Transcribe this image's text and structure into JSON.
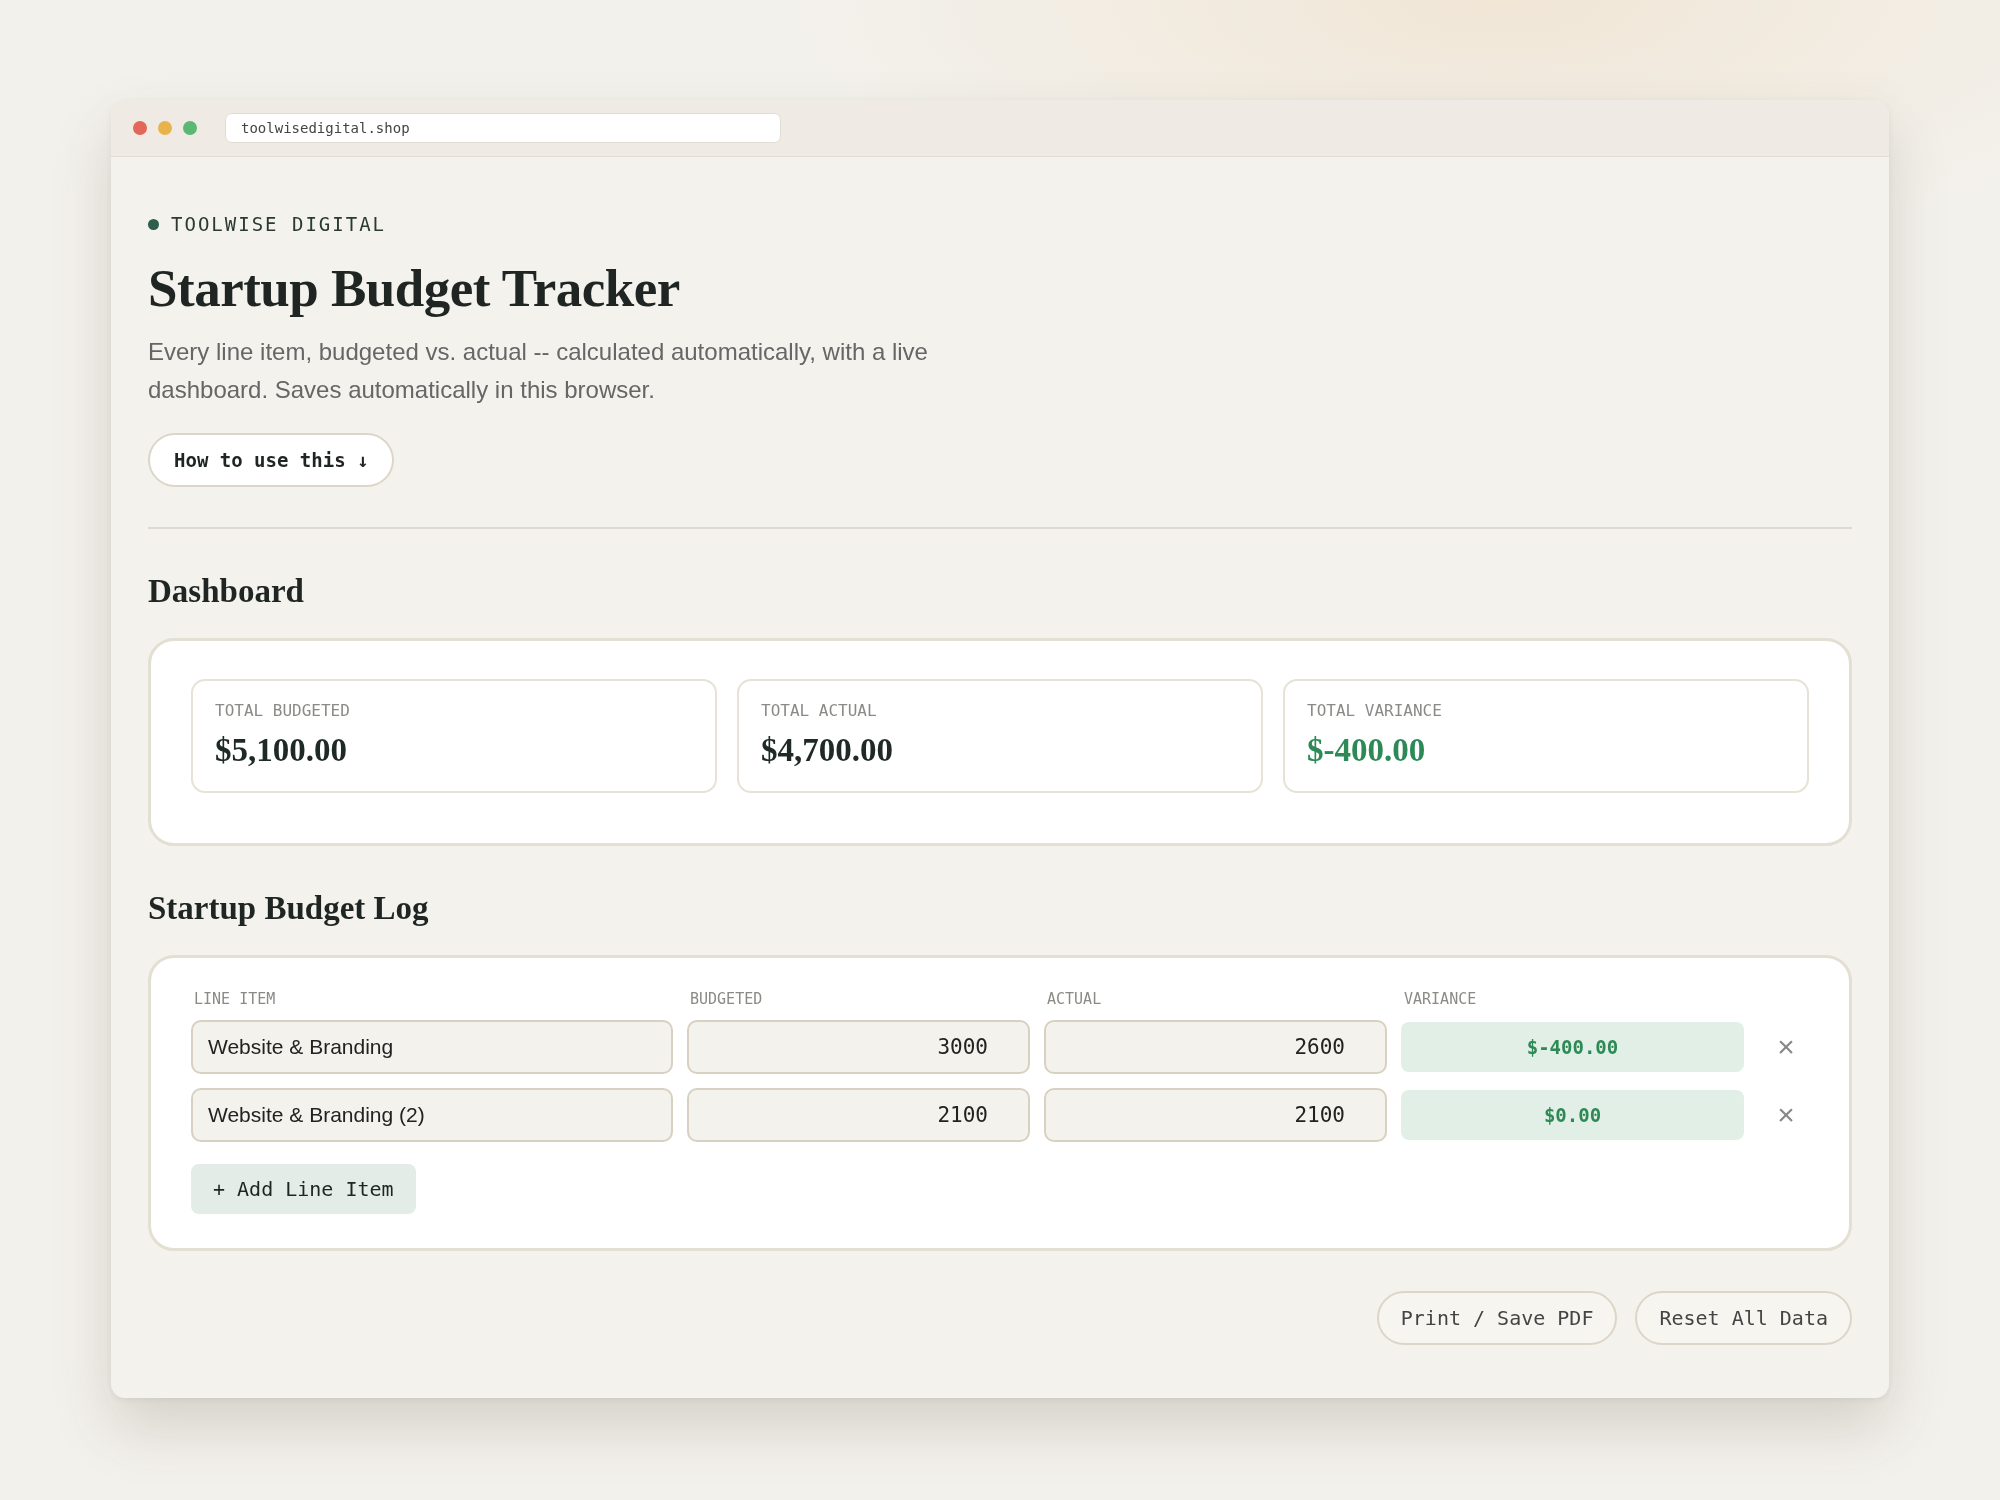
{
  "browser": {
    "url": "toolwisedigital.shop"
  },
  "brand": "TOOLWISE DIGITAL",
  "title": "Startup Budget Tracker",
  "description": "Every line item, budgeted vs. actual -- calculated automatically, with a live dashboard. Saves automatically in this browser.",
  "help_button": "How to use this ↓",
  "dashboard": {
    "heading": "Dashboard",
    "stats": [
      {
        "label": "TOTAL BUDGETED",
        "value": "$5,100.00",
        "kind": "plain"
      },
      {
        "label": "TOTAL ACTUAL",
        "value": "$4,700.00",
        "kind": "plain"
      },
      {
        "label": "TOTAL VARIANCE",
        "value": "$-400.00",
        "kind": "variance"
      }
    ]
  },
  "log": {
    "heading": "Startup Budget Log",
    "columns": [
      "LINE ITEM",
      "BUDGETED",
      "ACTUAL",
      "VARIANCE"
    ],
    "rows": [
      {
        "line_item": "Website & Branding",
        "budgeted": "3000",
        "actual": "2600",
        "variance": "$-400.00",
        "remove": "×"
      },
      {
        "line_item": "Website & Branding (2)",
        "budgeted": "2100",
        "actual": "2100",
        "variance": "$0.00",
        "remove": "×"
      }
    ],
    "add_button": "+ Add Line Item"
  },
  "footer_buttons": [
    "Print / Save PDF",
    "Reset All Data"
  ]
}
